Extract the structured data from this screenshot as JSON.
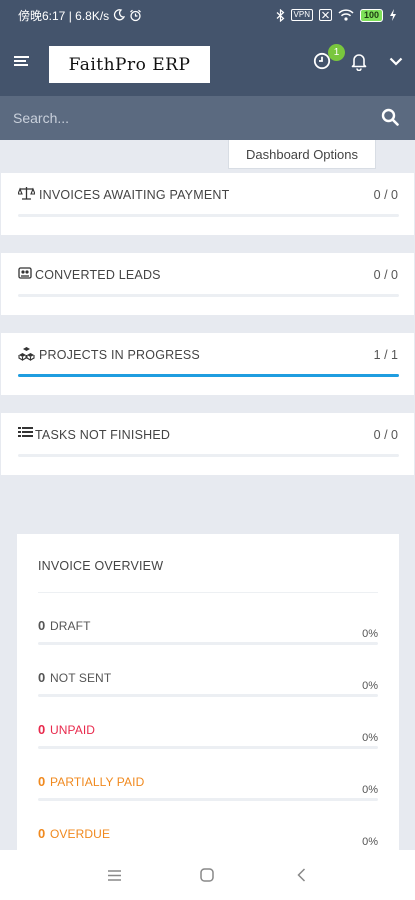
{
  "status_bar": {
    "time": "傍晚6:17 | 6.8K/s",
    "vpn": "VPN",
    "battery": "100"
  },
  "header": {
    "logo": "FaithPro ERP",
    "notification_badge": "1",
    "icons": [
      "hamburger-icon",
      "clock-icon",
      "bell-icon",
      "chevron-down-icon"
    ]
  },
  "search": {
    "placeholder": "Search..."
  },
  "dashboard_options_label": "Dashboard Options",
  "stats": [
    {
      "icon": "balance-scale-icon",
      "label": "INVOICES AWAITING PAYMENT",
      "value": "0 / 0",
      "progress": 0
    },
    {
      "icon": "converted-leads-icon",
      "label": "CONVERTED LEADS",
      "value": "0 / 0",
      "progress": 0
    },
    {
      "icon": "cubes-icon",
      "label": "PROJECTS IN PROGRESS",
      "value": "1 / 1",
      "progress": 1
    },
    {
      "icon": "tasks-icon",
      "label": "TASKS NOT FINISHED",
      "value": "0 / 0",
      "progress": 0
    }
  ],
  "invoice_overview": {
    "title": "INVOICE OVERVIEW",
    "rows": [
      {
        "count": "0",
        "label": "DRAFT",
        "percent": "0%",
        "color": "#555555"
      },
      {
        "count": "0",
        "label": "NOT SENT",
        "percent": "0%",
        "color": "#555555"
      },
      {
        "count": "0",
        "label": "UNPAID",
        "percent": "0%",
        "color": "#e8294c"
      },
      {
        "count": "0",
        "label": "PARTIALLY PAID",
        "percent": "0%",
        "color": "#f0891e"
      },
      {
        "count": "0",
        "label": "OVERDUE",
        "percent": "0%",
        "color": "#f0891e"
      }
    ]
  },
  "colors": {
    "header_bg": "#44546c",
    "search_bg": "#5b6a80",
    "progress_fill": "#1f9de0",
    "badge": "#79c63d"
  }
}
